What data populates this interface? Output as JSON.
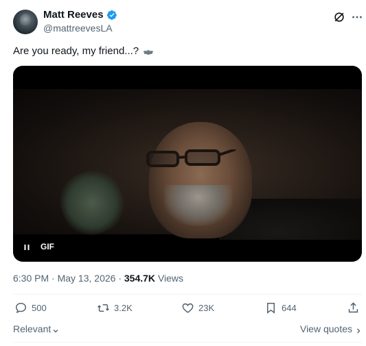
{
  "author": {
    "display_name": "Matt Reeves",
    "handle": "@mattreevesLA",
    "verified": true
  },
  "tweet": {
    "text": "Are you ready, my friend...?",
    "media": {
      "type": "GIF",
      "label": "GIF"
    }
  },
  "meta": {
    "time": "6:30 PM",
    "separator": "·",
    "date": "May 13, 2026",
    "views_count": "354.7K",
    "views_label": "Views"
  },
  "actions": {
    "replies": "500",
    "reposts": "3.2K",
    "likes": "23K",
    "bookmarks": "644"
  },
  "footer": {
    "sort_label": "Relevant",
    "view_quotes": "View quotes"
  },
  "colors": {
    "text_primary": "#0f1419",
    "text_secondary": "#536471",
    "verified_blue": "#1d9bf0",
    "divider": "#eff3f4"
  }
}
